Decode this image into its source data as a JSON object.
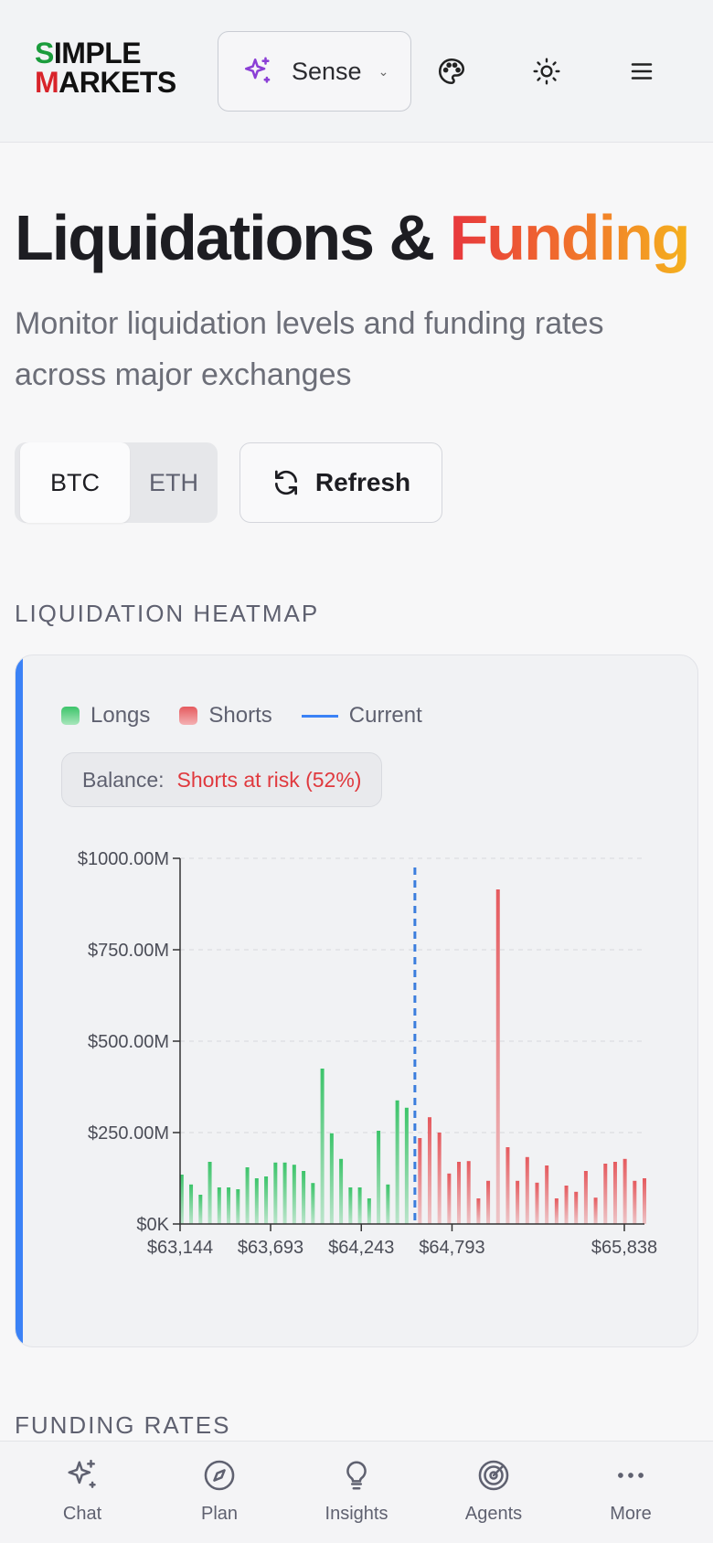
{
  "header": {
    "logo_line1": "IMPLE",
    "logo_line1_accent": "S",
    "logo_line2": "ARKETS",
    "logo_line2_accent": "M",
    "mode_button_label": "Sense",
    "icons": [
      "sparkles-icon",
      "palette-icon",
      "sun-icon",
      "menu-icon"
    ]
  },
  "page": {
    "title_main": "Liquidations &",
    "title_accent": "Funding",
    "subtitle": "Monitor liquidation levels and funding rates across major exchanges"
  },
  "controls": {
    "assets": [
      "BTC",
      "ETH"
    ],
    "selected_asset": "BTC",
    "refresh_label": "Refresh"
  },
  "sections": {
    "heatmap_label": "LIQUIDATION HEATMAP",
    "funding_label": "FUNDING RATES"
  },
  "heatmap_card": {
    "legend": {
      "longs": "Longs",
      "shorts": "Shorts",
      "current": "Current"
    },
    "balance_label": "Balance:",
    "balance_value": "Shorts at risk (52%)",
    "colors": {
      "longs": "#3cc46a",
      "shorts": "#e55a5e",
      "current": "#3b7ddd",
      "accent_bar": "#3b82f6"
    }
  },
  "chart_data": {
    "type": "bar",
    "title": "",
    "xlabel": "",
    "ylabel": "",
    "ylim": [
      0,
      1000
    ],
    "y_unit": "$M",
    "y_ticks": [
      "$0K",
      "$250.00M",
      "$500.00M",
      "$750.00M",
      "$1000.00M"
    ],
    "x_ticks": [
      "$63,144",
      "$63,693",
      "$64,243",
      "$64,793",
      "$65,838"
    ],
    "x_range": [
      63144,
      65960
    ],
    "current_price": 64568,
    "grid": true,
    "series": [
      {
        "name": "Longs",
        "values": [
          135,
          108,
          80,
          170,
          100,
          100,
          95,
          155,
          125,
          130,
          168,
          168,
          162,
          145,
          112,
          425,
          248,
          178,
          100,
          100,
          70,
          255,
          108,
          338,
          318
        ]
      },
      {
        "name": "Shorts",
        "values": [
          235,
          292,
          250,
          138,
          170,
          172,
          70,
          118,
          915,
          210,
          118,
          183,
          113,
          160,
          70,
          105,
          88,
          145,
          72,
          165,
          170,
          178,
          118,
          125
        ]
      }
    ]
  },
  "bottom_nav": [
    {
      "label": "Chat",
      "icon": "sparkles-icon"
    },
    {
      "label": "Plan",
      "icon": "compass-icon"
    },
    {
      "label": "Insights",
      "icon": "lightbulb-icon"
    },
    {
      "label": "Agents",
      "icon": "radar-icon"
    },
    {
      "label": "More",
      "icon": "more-dots-icon"
    }
  ]
}
